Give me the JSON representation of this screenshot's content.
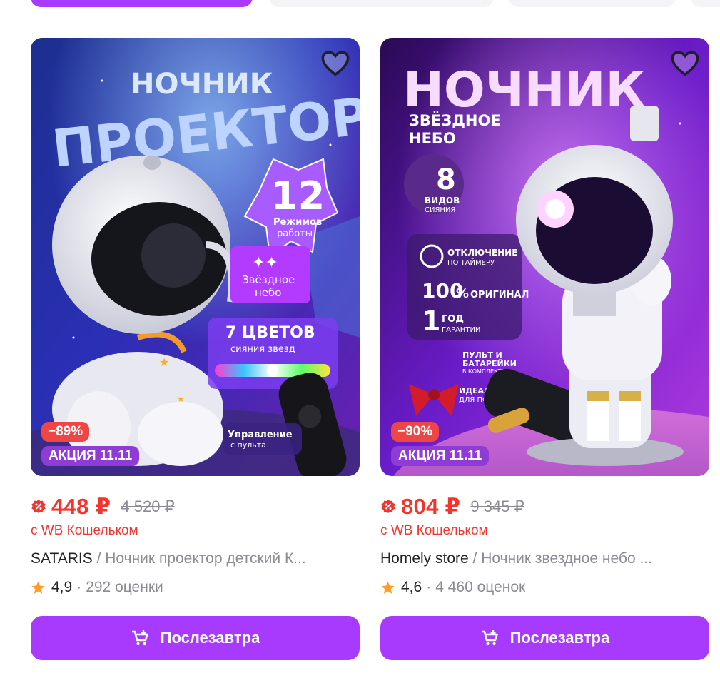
{
  "colors": {
    "accent": "#a73afd",
    "price": "#f2352e",
    "discount_badge": "#f04545",
    "promo_badge": "#8f3bd6",
    "muted": "#8b8b95"
  },
  "products": [
    {
      "image_text": {
        "line1": "НОЧНИК",
        "line2": "ПРОЕКТОР",
        "modes_number": "12",
        "modes_label1": "Режимов",
        "modes_label2": "работы",
        "feature1": "Звёздное",
        "feature2": "небо",
        "colors_label": "7 ЦВЕТОВ",
        "colors_sub": "сияния звезд",
        "control1": "Управление",
        "control2": "с пульта"
      },
      "discount": "−89%",
      "promo": "АКЦИЯ 11.11",
      "price": "448 ₽",
      "old_price": "4 520 ₽",
      "wallet_note": "с WB Кошельком",
      "brand": "SATARIS",
      "separator": " / ",
      "name": "Ночник проектор детский К...",
      "rating": "4,9",
      "dot": "·",
      "reviews": "292 оценки",
      "button": "Послезавтра"
    },
    {
      "image_text": {
        "line1": "НОЧНИК",
        "line2": "ЗВЁЗДНОЕ",
        "line3": "НЕБО",
        "kinds_number": "8",
        "kinds_label1": "ВИДОВ",
        "kinds_label2": "СИЯНИЯ",
        "timer1": "ОТКЛЮЧЕНИЕ",
        "timer2": "ПО ТАЙМЕРУ",
        "original_num": "100",
        "original_pct": "%",
        "original_label": "ОРИГИНАЛ",
        "warranty_num": "1",
        "warranty1": "ГОД",
        "warranty2": "ГАРАНТИИ",
        "remote1": "ПУЛЬТ И",
        "remote2": "БАТАРЕЙКИ",
        "remote3": "В КОМПЛЕКТЕ",
        "gift1": "ИДЕАЛЬНО",
        "gift2": "ДЛЯ ПОДАРКА"
      },
      "discount": "−90%",
      "promo": "АКЦИЯ 11.11",
      "price": "804 ₽",
      "old_price": "9 345 ₽",
      "wallet_note": "с WB Кошельком",
      "brand": "Homely store",
      "separator": " / ",
      "name": "Ночник звездное небо ...",
      "rating": "4,6",
      "dot": "·",
      "reviews": "4 460 оценок",
      "button": "Послезавтра"
    }
  ]
}
